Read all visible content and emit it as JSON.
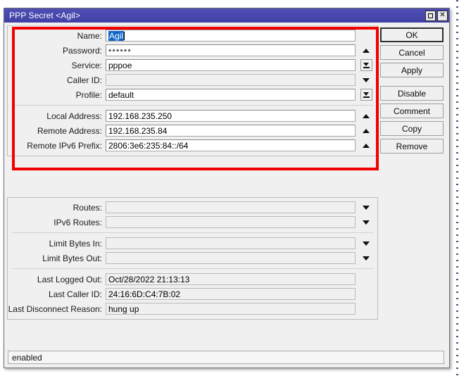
{
  "window": {
    "title": "PPP Secret <Agil>",
    "maximize_icon": "maximize-icon",
    "close_icon": "close-icon",
    "close_glyph": "✕"
  },
  "form": {
    "group_main": [
      {
        "label": "Name:",
        "value": "Agil",
        "widget": "none",
        "selected": true,
        "readonly": false
      },
      {
        "label": "Password:",
        "value": "******",
        "widget": "tri-up",
        "selected": false,
        "readonly": false
      },
      {
        "label": "Service:",
        "value": "pppoe",
        "widget": "drop-btn",
        "selected": false,
        "readonly": false
      },
      {
        "label": "Caller ID:",
        "value": "",
        "widget": "tri-down",
        "selected": false,
        "readonly": true
      },
      {
        "label": "Profile:",
        "value": "default",
        "widget": "drop-btn",
        "selected": false,
        "readonly": false
      }
    ],
    "group_addresses": [
      {
        "label": "Local Address:",
        "value": "192.168.235.250",
        "widget": "tri-up",
        "readonly": false
      },
      {
        "label": "Remote Address:",
        "value": "192.168.235.84",
        "widget": "tri-up",
        "readonly": false
      },
      {
        "label": "Remote IPv6 Prefix:",
        "value": "2806:3e6:235:84::/64",
        "widget": "tri-up",
        "readonly": false
      }
    ],
    "group_routes": [
      {
        "label": "Routes:",
        "value": "",
        "widget": "tri-down",
        "readonly": true
      },
      {
        "label": "IPv6 Routes:",
        "value": "",
        "widget": "tri-down",
        "readonly": true
      }
    ],
    "group_limits": [
      {
        "label": "Limit Bytes In:",
        "value": "",
        "widget": "tri-down",
        "readonly": true
      },
      {
        "label": "Limit Bytes Out:",
        "value": "",
        "widget": "tri-down",
        "readonly": true
      }
    ],
    "group_last": [
      {
        "label": "Last Logged Out:",
        "value": "Oct/28/2022 21:13:13",
        "widget": "none",
        "readonly": true
      },
      {
        "label": "Last Caller ID:",
        "value": "24:16:6D:C4:7B:02",
        "widget": "none",
        "readonly": true
      },
      {
        "label": "Last Disconnect Reason:",
        "value": "hung up",
        "widget": "none",
        "readonly": true
      }
    ]
  },
  "buttons": [
    {
      "label": "OK",
      "default": true
    },
    {
      "label": "Cancel",
      "default": false
    },
    {
      "label": "Apply",
      "default": false
    },
    {
      "label": "Disable",
      "default": false
    },
    {
      "label": "Comment",
      "default": false
    },
    {
      "label": "Copy",
      "default": false
    },
    {
      "label": "Remove",
      "default": false
    }
  ],
  "statusbar": {
    "text": "enabled"
  },
  "annotation": {
    "type": "rectangle-highlight",
    "color": "#f20000"
  },
  "colors": {
    "titlebar": "#4747ad",
    "selection": "#1064c8",
    "window_bg": "#f0f0f0",
    "highlight": "#f20000"
  }
}
